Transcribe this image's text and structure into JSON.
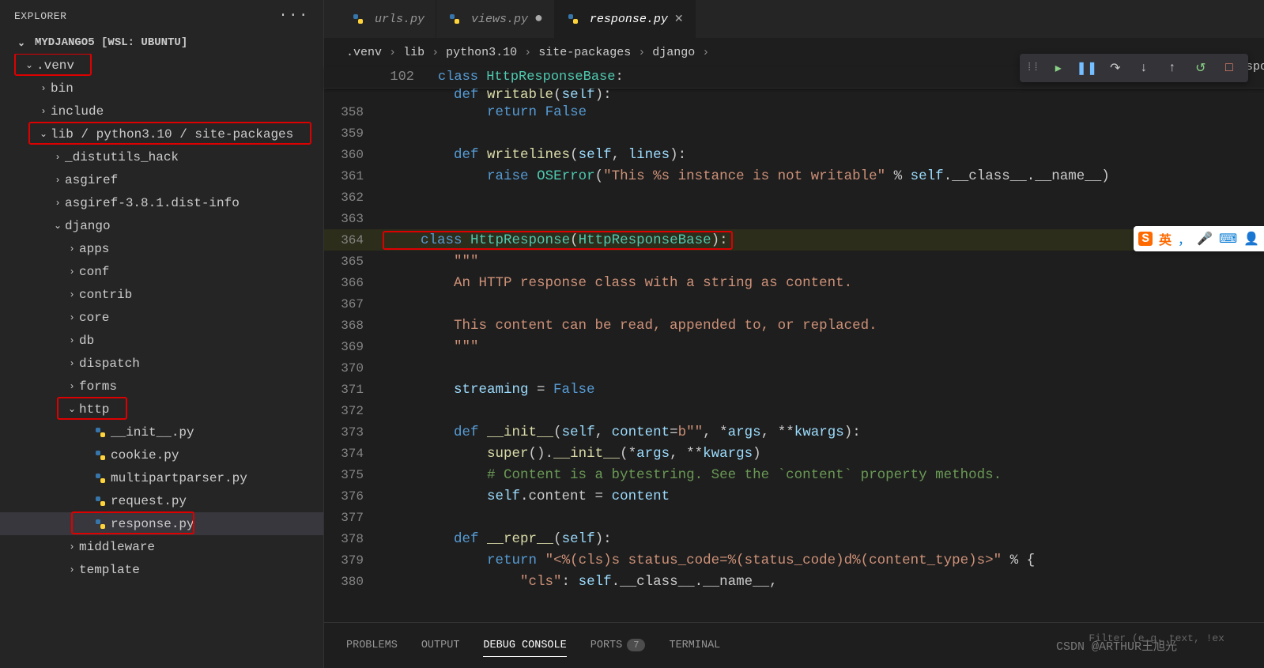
{
  "explorer": {
    "title": "EXPLORER",
    "project": "MYDJANGO5 [WSL: UBUNTU]"
  },
  "tree": [
    {
      "depth": 1,
      "open": true,
      "label": ".venv",
      "red": true
    },
    {
      "depth": 2,
      "open": false,
      "label": "bin"
    },
    {
      "depth": 2,
      "open": false,
      "label": "include"
    },
    {
      "depth": 2,
      "open": true,
      "label": "lib / python3.10 / site-packages",
      "red": true
    },
    {
      "depth": 3,
      "open": false,
      "label": "_distutils_hack"
    },
    {
      "depth": 3,
      "open": false,
      "label": "asgiref"
    },
    {
      "depth": 3,
      "open": false,
      "label": "asgiref-3.8.1.dist-info"
    },
    {
      "depth": 3,
      "open": true,
      "label": "django"
    },
    {
      "depth": 4,
      "open": false,
      "label": "apps"
    },
    {
      "depth": 4,
      "open": false,
      "label": "conf"
    },
    {
      "depth": 4,
      "open": false,
      "label": "contrib"
    },
    {
      "depth": 4,
      "open": false,
      "label": "core"
    },
    {
      "depth": 4,
      "open": false,
      "label": "db"
    },
    {
      "depth": 4,
      "open": false,
      "label": "dispatch"
    },
    {
      "depth": 4,
      "open": false,
      "label": "forms"
    },
    {
      "depth": 4,
      "open": true,
      "label": "http",
      "red": true
    },
    {
      "depth": 5,
      "file": true,
      "label": "__init__.py"
    },
    {
      "depth": 5,
      "file": true,
      "label": "cookie.py"
    },
    {
      "depth": 5,
      "file": true,
      "label": "multipartparser.py"
    },
    {
      "depth": 5,
      "file": true,
      "label": "request.py"
    },
    {
      "depth": 5,
      "file": true,
      "label": "response.py",
      "red": true,
      "active": true
    },
    {
      "depth": 4,
      "open": false,
      "label": "middleware"
    },
    {
      "depth": 4,
      "open": false,
      "label": "template"
    }
  ],
  "tabs": [
    {
      "label": "urls.py",
      "icon": "py",
      "state": "clean"
    },
    {
      "label": "views.py",
      "icon": "py",
      "state": "dirty"
    },
    {
      "label": "response.py",
      "icon": "py",
      "state": "active"
    }
  ],
  "breadcrumbs": [
    ".venv",
    "lib",
    "python3.10",
    "site-packages",
    "django"
  ],
  "breadcrumb_tail": "tpResponse",
  "sticky": {
    "ln": "102",
    "text_pre": "class ",
    "cls": "HttpResponseBase",
    "text_post": ":"
  },
  "code": [
    {
      "ln": "358",
      "html": "            <span class='k'>return</span> <span class='k'>False</span>"
    },
    {
      "ln": "359",
      "html": ""
    },
    {
      "ln": "360",
      "html": "        <span class='k'>def</span> <span class='fn'>writelines</span>(<span class='v'>self</span>, <span class='v'>lines</span>):"
    },
    {
      "ln": "361",
      "html": "            <span class='k'>raise</span> <span class='cl'>OSError</span>(<span class='s'>\"This %s instance is not writable\"</span> % <span class='v'>self</span>.__class__.__name__)"
    },
    {
      "ln": "362",
      "html": ""
    },
    {
      "ln": "363",
      "html": ""
    },
    {
      "ln": "364",
      "html": "<span class='redbox-code'>    <span class='k'>class</span> <span class='cl'>HttpResponse</span>(<span class='cl'>HttpResponseBase</span>):</span>",
      "hl": true
    },
    {
      "ln": "365",
      "html": "        <span class='s'>\"\"\"</span>"
    },
    {
      "ln": "366",
      "html": "        <span class='s'>An HTTP response class with a string as content.</span>"
    },
    {
      "ln": "367",
      "html": ""
    },
    {
      "ln": "368",
      "html": "        <span class='s'>This content can be read, appended to, or replaced.</span>"
    },
    {
      "ln": "369",
      "html": "        <span class='s'>\"\"\"</span>"
    },
    {
      "ln": "370",
      "html": ""
    },
    {
      "ln": "371",
      "html": "        <span class='v'>streaming</span> = <span class='k'>False</span>"
    },
    {
      "ln": "372",
      "html": ""
    },
    {
      "ln": "373",
      "html": "        <span class='k'>def</span> <span class='fn'>__init__</span>(<span class='v'>self</span>, <span class='v'>content</span>=<span class='s'>b\"\"</span>, *<span class='v'>args</span>, **<span class='v'>kwargs</span>):"
    },
    {
      "ln": "374",
      "html": "            <span class='fn'>super</span>().<span class='fn'>__init__</span>(*<span class='v'>args</span>, **<span class='v'>kwargs</span>)"
    },
    {
      "ln": "375",
      "html": "            <span class='c'># Content is a bytestring. See the `content` property methods.</span>"
    },
    {
      "ln": "376",
      "html": "            <span class='v'>self</span>.content = <span class='v'>content</span>"
    },
    {
      "ln": "377",
      "html": ""
    },
    {
      "ln": "378",
      "html": "        <span class='k'>def</span> <span class='fn'>__repr__</span>(<span class='v'>self</span>):"
    },
    {
      "ln": "379",
      "html": "            <span class='k'>return</span> <span class='s'>\"&lt;%(cls)s status_code=%(status_code)d%(content_type)s&gt;\"</span> % {"
    },
    {
      "ln": "380",
      "html": "                <span class='s'>\"cls\"</span>: <span class='v'>self</span>.__class__.__name__,"
    }
  ],
  "panel": {
    "tabs": [
      "PROBLEMS",
      "OUTPUT",
      "DEBUG CONSOLE",
      "PORTS",
      "TERMINAL"
    ],
    "active": 2,
    "ports_badge": "7",
    "filter_placeholder": "Filter (e.g. text, !ex"
  },
  "debug_tools": [
    "grip",
    "continue",
    "pause",
    "step-over",
    "step-into",
    "step-out",
    "restart",
    "stop"
  ],
  "watermark": "CSDN @ARTHUR王旭光",
  "ime": {
    "glyphs": [
      "S",
      "英",
      "，",
      "🎤",
      "⌨",
      "👤"
    ]
  }
}
